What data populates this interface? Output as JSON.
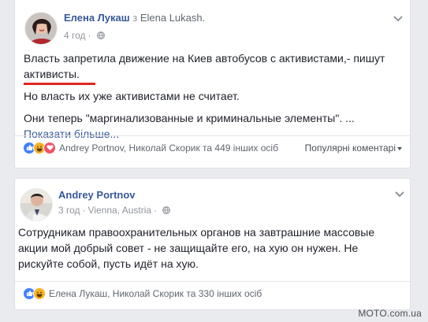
{
  "posts": [
    {
      "author": "Елена Лукаш",
      "via_word": "з",
      "via_name": "Elena Lukash.",
      "time": "4 год",
      "text": {
        "l1": "Власть запретила движение на Киев автобусов с активистами,- пишут",
        "l2": "активисты.",
        "l3": "Но власть их уже активистами не считает.",
        "l4": "Они теперь \"маргинализованные и криминальные элементы\". ...",
        "see_more": "Показати більше..."
      },
      "reactions": {
        "icons": [
          "like",
          "haha",
          "love"
        ],
        "names": "Andrey Portnov, Николай Скорик та 449 інших осіб"
      },
      "sort_label": "Популярні коментарі"
    },
    {
      "author": "Andrey Portnov",
      "time": "3 год",
      "location": "Vienna, Austria",
      "text": {
        "l1": "Сотрудникам правоохранительных органов на завтрашние массовые",
        "l2": "акции мой добрый совет - не защищайте его, на хую он нужен. Не",
        "l3": "рискуйте собой, пусть идёт на хую."
      },
      "reactions": {
        "icons": [
          "like",
          "haha"
        ],
        "names": "Елена Лукаш, Николай Скорик та 330 інших осіб"
      }
    }
  ],
  "watermark": "MOTO.com.ua",
  "colors": {
    "link": "#365899",
    "underline": "#e0271f",
    "like": "#4080ff"
  }
}
